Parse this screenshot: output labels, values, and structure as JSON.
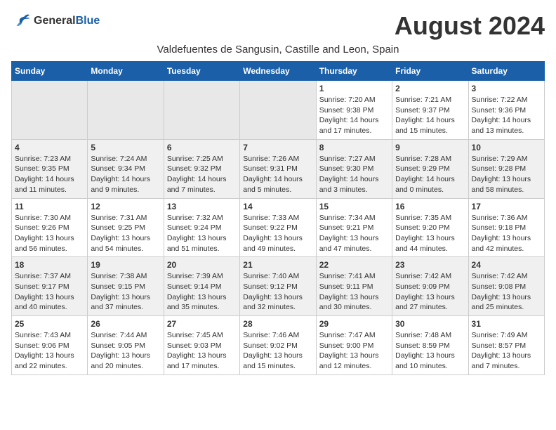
{
  "logo": {
    "line1": "General",
    "line2": "Blue"
  },
  "title": "August 2024",
  "subtitle": "Valdefuentes de Sangusin, Castille and Leon, Spain",
  "days_of_week": [
    "Sunday",
    "Monday",
    "Tuesday",
    "Wednesday",
    "Thursday",
    "Friday",
    "Saturday"
  ],
  "weeks": [
    [
      {
        "day": "",
        "empty": true
      },
      {
        "day": "",
        "empty": true
      },
      {
        "day": "",
        "empty": true
      },
      {
        "day": "",
        "empty": true
      },
      {
        "day": "1",
        "sunrise": "7:20 AM",
        "sunset": "9:38 PM",
        "daylight": "14 hours and 17 minutes."
      },
      {
        "day": "2",
        "sunrise": "7:21 AM",
        "sunset": "9:37 PM",
        "daylight": "14 hours and 15 minutes."
      },
      {
        "day": "3",
        "sunrise": "7:22 AM",
        "sunset": "9:36 PM",
        "daylight": "14 hours and 13 minutes."
      }
    ],
    [
      {
        "day": "4",
        "sunrise": "7:23 AM",
        "sunset": "9:35 PM",
        "daylight": "14 hours and 11 minutes."
      },
      {
        "day": "5",
        "sunrise": "7:24 AM",
        "sunset": "9:34 PM",
        "daylight": "14 hours and 9 minutes."
      },
      {
        "day": "6",
        "sunrise": "7:25 AM",
        "sunset": "9:32 PM",
        "daylight": "14 hours and 7 minutes."
      },
      {
        "day": "7",
        "sunrise": "7:26 AM",
        "sunset": "9:31 PM",
        "daylight": "14 hours and 5 minutes."
      },
      {
        "day": "8",
        "sunrise": "7:27 AM",
        "sunset": "9:30 PM",
        "daylight": "14 hours and 3 minutes."
      },
      {
        "day": "9",
        "sunrise": "7:28 AM",
        "sunset": "9:29 PM",
        "daylight": "14 hours and 0 minutes."
      },
      {
        "day": "10",
        "sunrise": "7:29 AM",
        "sunset": "9:28 PM",
        "daylight": "13 hours and 58 minutes."
      }
    ],
    [
      {
        "day": "11",
        "sunrise": "7:30 AM",
        "sunset": "9:26 PM",
        "daylight": "13 hours and 56 minutes."
      },
      {
        "day": "12",
        "sunrise": "7:31 AM",
        "sunset": "9:25 PM",
        "daylight": "13 hours and 54 minutes."
      },
      {
        "day": "13",
        "sunrise": "7:32 AM",
        "sunset": "9:24 PM",
        "daylight": "13 hours and 51 minutes."
      },
      {
        "day": "14",
        "sunrise": "7:33 AM",
        "sunset": "9:22 PM",
        "daylight": "13 hours and 49 minutes."
      },
      {
        "day": "15",
        "sunrise": "7:34 AM",
        "sunset": "9:21 PM",
        "daylight": "13 hours and 47 minutes."
      },
      {
        "day": "16",
        "sunrise": "7:35 AM",
        "sunset": "9:20 PM",
        "daylight": "13 hours and 44 minutes."
      },
      {
        "day": "17",
        "sunrise": "7:36 AM",
        "sunset": "9:18 PM",
        "daylight": "13 hours and 42 minutes."
      }
    ],
    [
      {
        "day": "18",
        "sunrise": "7:37 AM",
        "sunset": "9:17 PM",
        "daylight": "13 hours and 40 minutes."
      },
      {
        "day": "19",
        "sunrise": "7:38 AM",
        "sunset": "9:15 PM",
        "daylight": "13 hours and 37 minutes."
      },
      {
        "day": "20",
        "sunrise": "7:39 AM",
        "sunset": "9:14 PM",
        "daylight": "13 hours and 35 minutes."
      },
      {
        "day": "21",
        "sunrise": "7:40 AM",
        "sunset": "9:12 PM",
        "daylight": "13 hours and 32 minutes."
      },
      {
        "day": "22",
        "sunrise": "7:41 AM",
        "sunset": "9:11 PM",
        "daylight": "13 hours and 30 minutes."
      },
      {
        "day": "23",
        "sunrise": "7:42 AM",
        "sunset": "9:09 PM",
        "daylight": "13 hours and 27 minutes."
      },
      {
        "day": "24",
        "sunrise": "7:42 AM",
        "sunset": "9:08 PM",
        "daylight": "13 hours and 25 minutes."
      }
    ],
    [
      {
        "day": "25",
        "sunrise": "7:43 AM",
        "sunset": "9:06 PM",
        "daylight": "13 hours and 22 minutes."
      },
      {
        "day": "26",
        "sunrise": "7:44 AM",
        "sunset": "9:05 PM",
        "daylight": "13 hours and 20 minutes."
      },
      {
        "day": "27",
        "sunrise": "7:45 AM",
        "sunset": "9:03 PM",
        "daylight": "13 hours and 17 minutes."
      },
      {
        "day": "28",
        "sunrise": "7:46 AM",
        "sunset": "9:02 PM",
        "daylight": "13 hours and 15 minutes."
      },
      {
        "day": "29",
        "sunrise": "7:47 AM",
        "sunset": "9:00 PM",
        "daylight": "13 hours and 12 minutes."
      },
      {
        "day": "30",
        "sunrise": "7:48 AM",
        "sunset": "8:59 PM",
        "daylight": "13 hours and 10 minutes."
      },
      {
        "day": "31",
        "sunrise": "7:49 AM",
        "sunset": "8:57 PM",
        "daylight": "13 hours and 7 minutes."
      }
    ]
  ],
  "colors": {
    "header_bg": "#1a5fa8",
    "header_text": "#ffffff",
    "row_odd": "#ffffff",
    "row_even": "#f0f0f0",
    "empty_cell": "#e0e0e0"
  }
}
